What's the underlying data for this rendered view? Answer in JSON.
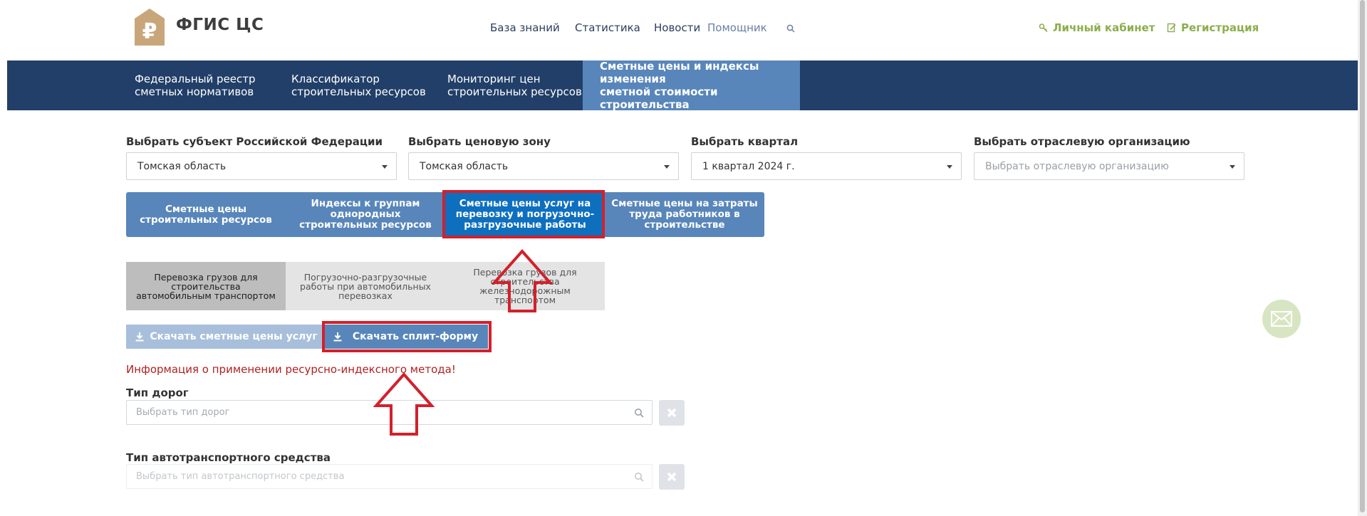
{
  "header": {
    "logo_text": "ФГИС ЦС",
    "links": [
      "База знаний",
      "Статистика",
      "Новости",
      "Помощник"
    ],
    "account": "Личный кабинет",
    "register": "Регистрация"
  },
  "nav": {
    "items": [
      {
        "line1": "Федеральный реестр",
        "line2": "сметных нормативов"
      },
      {
        "line1": "Классификатор",
        "line2": "строительных ресурсов"
      },
      {
        "line1": "Мониторинг цен",
        "line2": "строительных ресурсов"
      },
      {
        "line1": "Сметные цены и индексы изменения",
        "line2": "сметной стоимости строительства"
      }
    ]
  },
  "filters": [
    {
      "label": "Выбрать субъект Российской Федерации",
      "value": "Томская область"
    },
    {
      "label": "Выбрать ценовую зону",
      "value": "Томская область"
    },
    {
      "label": "Выбрать квартал",
      "value": "1 квартал 2024 г."
    },
    {
      "label": "Выбрать отраслевую организацию",
      "placeholder": "Выбрать отраслевую организацию"
    }
  ],
  "main_tabs": [
    {
      "l1": "Сметные цены",
      "l2": "строительных ресурсов",
      "l3": ""
    },
    {
      "l1": "Индексы к группам",
      "l2": "однородных",
      "l3": "строительных ресурсов"
    },
    {
      "l1": "Сметные цены услуг на",
      "l2": "перевозку и погрузочно-",
      "l3": "разгрузочные работы"
    },
    {
      "l1": "Сметные цены на затраты",
      "l2": "труда работников в",
      "l3": "строительстве"
    }
  ],
  "sub_tabs": [
    {
      "l1": "Перевозка грузов для",
      "l2": "строительства",
      "l3": "автомобильным транспортом",
      "l4": ""
    },
    {
      "l1": "Погрузочно-разгрузочные",
      "l2": "работы при автомобильных",
      "l3": "перевозках",
      "l4": ""
    },
    {
      "l1": "Перевозка грузов для",
      "l2": "строительства",
      "l3": "железнодорожным",
      "l4": "транспортом"
    }
  ],
  "downloads": {
    "prices": "Скачать сметные цены услуг",
    "split": "Скачать сплит-форму"
  },
  "info_link": "Информация о применении ресурсно-индексного метода!",
  "fields": [
    {
      "label": "Тип дорог",
      "placeholder": "Выбрать тип дорог"
    },
    {
      "label": "Тип автотранспортного средства",
      "placeholder": "Выбрать тип автотранспортного средства"
    }
  ],
  "colors": {
    "nav_bg": "#213f68",
    "nav_active": "#5886ba",
    "tab_active": "#0e6fbf",
    "accent_green": "#8cae4c",
    "annotation_red": "#d3202b"
  }
}
